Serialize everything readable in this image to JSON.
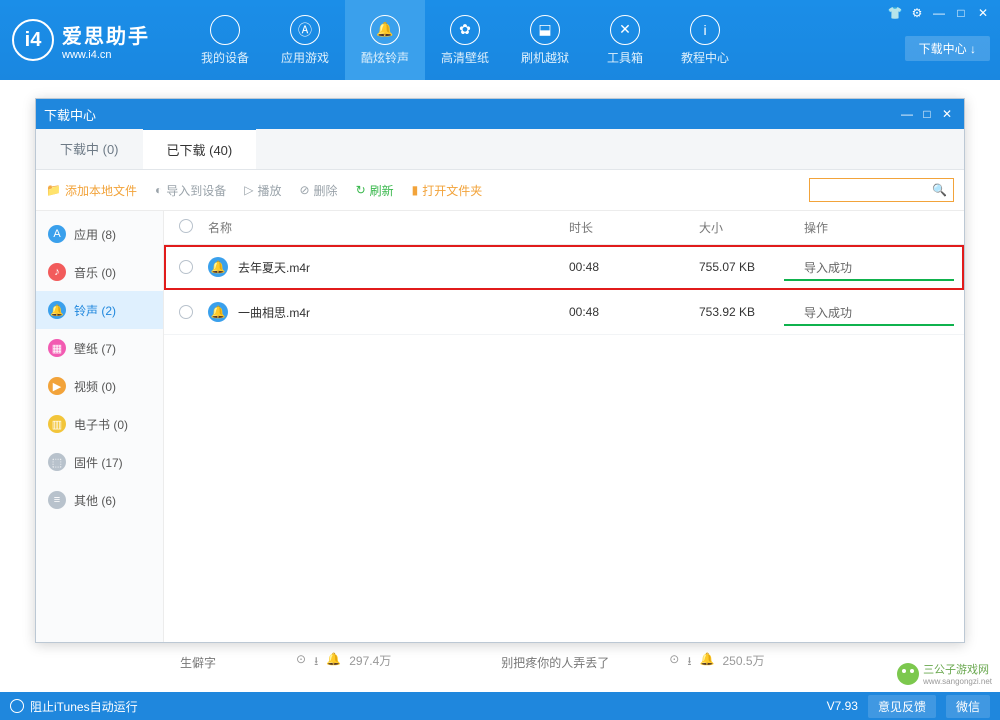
{
  "header": {
    "logo_cn": "爱思助手",
    "logo_url": "www.i4.cn",
    "nav": [
      {
        "label": "我的设备"
      },
      {
        "label": "应用游戏"
      },
      {
        "label": "酷炫铃声"
      },
      {
        "label": "高清壁纸"
      },
      {
        "label": "刷机越狱"
      },
      {
        "label": "工具箱"
      },
      {
        "label": "教程中心"
      }
    ],
    "dl_center": "下载中心 ↓"
  },
  "modal": {
    "title": "下载中心",
    "tabs": {
      "downloading": "下载中 (0)",
      "downloaded": "已下载 (40)"
    },
    "toolbar": {
      "add": "添加本地文件",
      "import": "导入到设备",
      "play": "播放",
      "delete": "删除",
      "refresh": "刷新",
      "open_folder": "打开文件夹"
    },
    "columns": {
      "name": "名称",
      "duration": "时长",
      "size": "大小",
      "action": "操作"
    },
    "sidebar": [
      {
        "label": "应用 (8)",
        "color": "#3aa0ec",
        "icon": "A"
      },
      {
        "label": "音乐 (0)",
        "color": "#f25b5b",
        "icon": "♪"
      },
      {
        "label": "铃声 (2)",
        "color": "#3aa0ec",
        "icon": "🔔"
      },
      {
        "label": "壁纸 (7)",
        "color": "#f25bb2",
        "icon": "▦"
      },
      {
        "label": "视频 (0)",
        "color": "#f2a33a",
        "icon": "▶"
      },
      {
        "label": "电子书 (0)",
        "color": "#f2c53a",
        "icon": "▥"
      },
      {
        "label": "固件 (17)",
        "color": "#b8c2cc",
        "icon": "⬚"
      },
      {
        "label": "其他 (6)",
        "color": "#b8c2cc",
        "icon": "≡"
      }
    ],
    "rows": [
      {
        "name": "去年夏天.m4r",
        "duration": "00:48",
        "size": "755.07 KB",
        "status": "导入成功"
      },
      {
        "name": "一曲相思.m4r",
        "duration": "00:48",
        "size": "753.92 KB",
        "status": "导入成功"
      }
    ]
  },
  "bg": {
    "song1": "生僻字",
    "count1": "297.4万",
    "song2": "别把疼你的人弄丢了",
    "count2": "250.5万"
  },
  "status": {
    "itunes": "阻止iTunes自动运行",
    "version": "V7.93",
    "feedback": "意见反馈",
    "wechat": "微信"
  },
  "watermark": "三公子游戏网"
}
